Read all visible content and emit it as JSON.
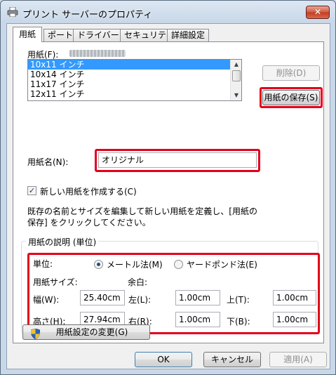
{
  "window": {
    "title": "プリント サーバーのプロパティ",
    "close_label": "✕"
  },
  "tabs": [
    {
      "label": "用紙",
      "active": true
    },
    {
      "label": "ポート",
      "active": false
    },
    {
      "label": "ドライバー",
      "active": false
    },
    {
      "label": "セキュリティ",
      "active": false
    },
    {
      "label": "詳細設定",
      "active": false
    }
  ],
  "forms_tab": {
    "paper_label": "用紙(F):",
    "paper_list": [
      "10x11 インチ",
      "10x14 インチ",
      "11x17 インチ",
      "12x11 インチ"
    ],
    "selected_index": 0,
    "delete_button": "削除(D)",
    "save_button": "用紙の保存(S)",
    "form_name_label": "用紙名(N):",
    "form_name_value": "オリジナル",
    "create_new_label": "新しい用紙を作成する(C)",
    "create_new_checked": true,
    "description_line1": "既存の名前とサイズを編集して新しい用紙を定義し、[用紙の",
    "description_line2": "保存] をクリックしてください。",
    "group_title": "用紙の説明 (単位)",
    "units_label": "単位:",
    "metric_label": "メートル法(M)",
    "imperial_label": "ヤードポンド法(E)",
    "selected_unit": "metric",
    "paper_size_label": "用紙サイズ:",
    "margins_label": "余白:",
    "width_label": "幅(W):",
    "width_value": "25.40cm",
    "height_label": "高さ(H):",
    "height_value": "27.94cm",
    "left_label": "左(L):",
    "left_value": "1.00cm",
    "right_label": "右(R):",
    "right_value": "1.00cm",
    "top_label": "上(T):",
    "top_value": "1.00cm",
    "bottom_label": "下(B):",
    "bottom_value": "1.00cm",
    "change_settings_button": "用紙設定の変更(G)"
  },
  "footer": {
    "ok": "OK",
    "cancel": "キャンセル",
    "apply": "適用(A)"
  },
  "colors": {
    "highlight_box": "#e3001b",
    "selection": "#3399ff"
  }
}
